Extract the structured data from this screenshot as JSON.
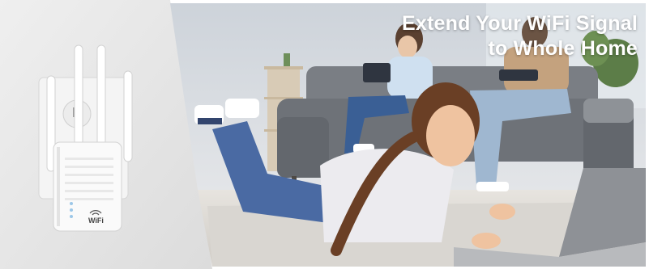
{
  "headline": {
    "line1": "Extend Your WiFi Signal",
    "line2": "to Whole Home"
  },
  "product": {
    "logo_text": "WiFi",
    "device": "wifi-range-extender",
    "antenna_count": 4
  },
  "scene": {
    "subject": "girl-lying-on-floor-using-laptop",
    "background": "family-on-sofa-with-devices"
  },
  "colors": {
    "background_left": "#e6e6e6",
    "wall": "#d7dbe0",
    "sofa": "#6f7379",
    "jeans": "#4a6aa3",
    "headline_text": "#ffffff"
  }
}
